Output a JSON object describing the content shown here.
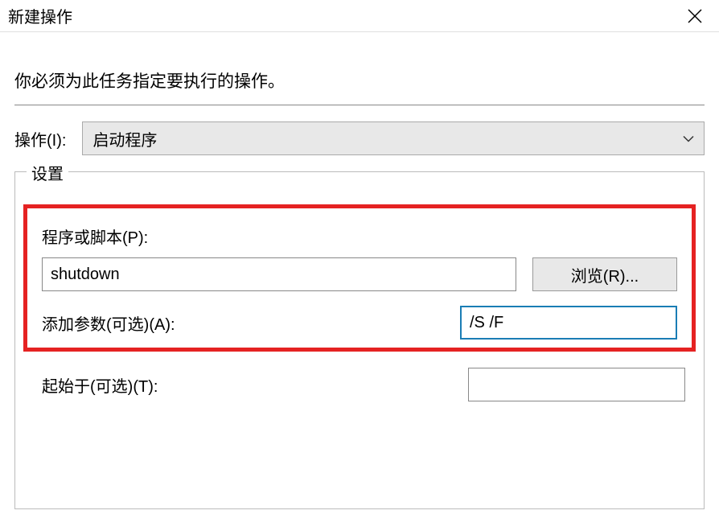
{
  "titlebar": {
    "title": "新建操作"
  },
  "instruction": "你必须为此任务指定要执行的操作。",
  "action": {
    "label": "操作(I):",
    "selected": "启动程序"
  },
  "settings": {
    "legend": "设置",
    "program": {
      "label": "程序或脚本(P):",
      "value": "shutdown",
      "browse": "浏览(R)..."
    },
    "arguments": {
      "label": "添加参数(可选)(A):",
      "value": "/S /F"
    },
    "startin": {
      "label": "起始于(可选)(T):",
      "value": ""
    }
  }
}
